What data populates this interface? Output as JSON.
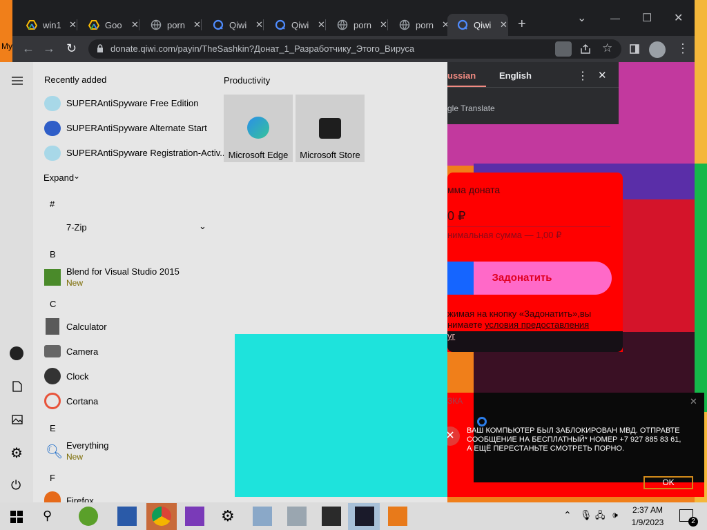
{
  "desktop": {
    "partial_label": "My"
  },
  "browser": {
    "tabs": [
      {
        "title": "win1"
      },
      {
        "title": "Goo"
      },
      {
        "title": "porn"
      },
      {
        "title": "Qiwi"
      },
      {
        "title": "Qiwi"
      },
      {
        "title": "porn"
      },
      {
        "title": "porn"
      },
      {
        "title": "Qiwi"
      }
    ],
    "new_tab_glyph": "+",
    "url": "donate.qiwi.com/payin/TheSashkin?Донат_1_Разработчику_Этого_Вируса",
    "window_controls": {
      "chevron": "⌄",
      "minimize": "—",
      "maximize": "☐",
      "close": "✕"
    }
  },
  "translate_popup": {
    "tab_russian": "ussian",
    "tab_english": "English",
    "footer": "gle Translate",
    "more_glyph": "⋮",
    "close_glyph": "✕"
  },
  "donation_page": {
    "amount_label": "мма доната",
    "amount_value": "0 ₽",
    "min_amount": "нимальная сумма — 1,00 ₽",
    "donate_button": "Задонатить",
    "terms_line1": "жимая на кнопку «Задонатить»,вы",
    "terms_line2_prefix": "нимаете ",
    "terms_link": "условия предоставления",
    "terms_line3": "уг",
    "dlg_header_partial": "ЗКА"
  },
  "lock_dialog": {
    "message": "ВАШ КОМПЬЮТЕР БЫЛ ЗАБЛОКИРОВАН МВД. ОТПРАВТЕ СООБЩЕНИЕ НА БЕСПЛАТНЫЙ* НОМЕР +7 927 885 83 61, А ЕЩЁ ПЕРЕСТАНЬТЕ СМОТРЕТЬ ПОРНО.",
    "ok_label": "OK",
    "close_glyph": "✕"
  },
  "start_menu": {
    "recently_added_title": "Recently added",
    "recent": [
      {
        "label": "SUPERAntiSpyware Free Edition"
      },
      {
        "label": "SUPERAntiSpyware Alternate Start"
      },
      {
        "label": "SUPERAntiSpyware Registration-Activ..."
      }
    ],
    "expand_label": "Expand",
    "letters": {
      "hash": "#",
      "b": "B",
      "c": "C",
      "e": "E",
      "f": "F"
    },
    "apps": {
      "zip": "7-Zip",
      "blend": "Blend for Visual Studio 2015",
      "blend_badge": "New",
      "calculator": "Calculator",
      "camera": "Camera",
      "clock": "Clock",
      "cortana": "Cortana",
      "everything": "Everything",
      "everything_badge": "New",
      "firefox": "Firefox"
    },
    "productivity_title": "Productivity",
    "tiles": [
      {
        "label": "Microsoft Edge"
      },
      {
        "label": "Microsoft Store"
      }
    ]
  },
  "taskbar": {
    "time": "2:37 AM",
    "date": "1/9/2023",
    "notification_count": "2"
  },
  "colors": {
    "desktop_orange": "#f07f1a",
    "qiwi_red": "#ff0000",
    "qiwi_pink": "#ff69c8",
    "cyan_block": "#1ee3dc"
  }
}
